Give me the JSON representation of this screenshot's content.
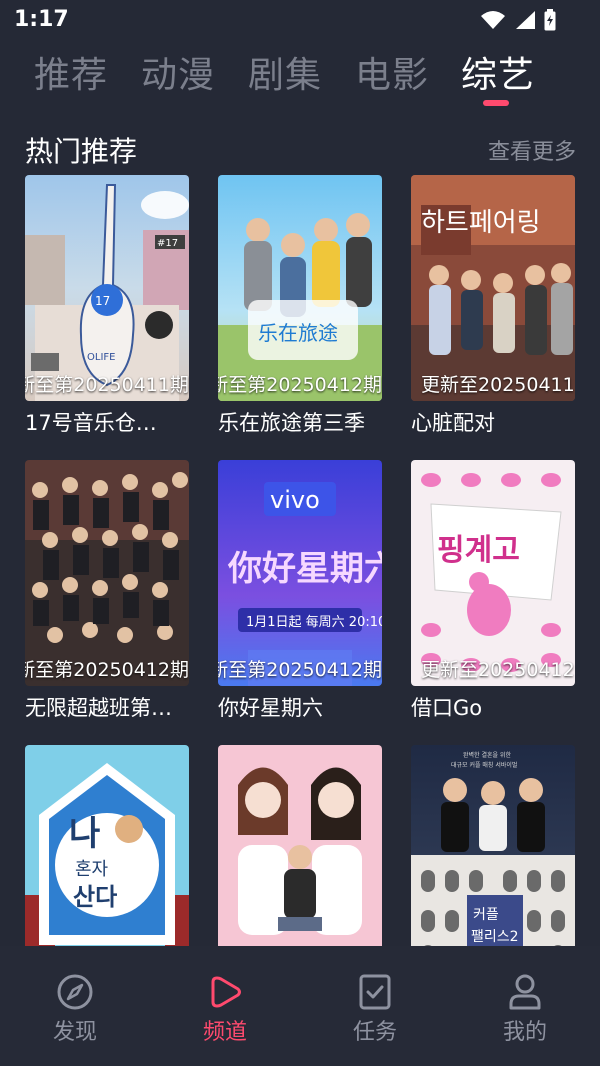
{
  "status_bar": {
    "time": "1:17"
  },
  "top_tabs": [
    {
      "label": "推荐"
    },
    {
      "label": "动漫"
    },
    {
      "label": "剧集"
    },
    {
      "label": "电影"
    },
    {
      "label": "综艺",
      "active": true
    }
  ],
  "section": {
    "title": "热门推荐",
    "more_label": "查看更多"
  },
  "cards": [
    {
      "title": "17号音乐仓…",
      "caption": "新至第20250411期",
      "poster_label": "17号音乐仓"
    },
    {
      "title": "乐在旅途第三季",
      "caption": "新至第20250412期",
      "poster_label": "乐在旅途"
    },
    {
      "title": "心脏配对",
      "caption": "更新至20250411",
      "poster_label": "하트페어링"
    },
    {
      "title": "无限超越班第…",
      "caption": "新至第20250412期",
      "poster_label": ""
    },
    {
      "title": "你好星期六",
      "caption": "新至第20250412期",
      "poster_label": "vivo"
    },
    {
      "title": "借口Go",
      "caption": "更新至20250412",
      "poster_label": "핑계고"
    },
    {
      "title": "",
      "caption": "",
      "poster_label": "나 혼자 산다"
    },
    {
      "title": "",
      "caption": "",
      "poster_label": ""
    },
    {
      "title": "",
      "caption": "",
      "poster_label": "커플 팰리스2"
    }
  ],
  "bottom_nav": [
    {
      "label": "发现",
      "icon": "compass-icon"
    },
    {
      "label": "频道",
      "icon": "play-icon",
      "active": true
    },
    {
      "label": "任务",
      "icon": "task-icon"
    },
    {
      "label": "我的",
      "icon": "user-icon"
    }
  ],
  "colors": {
    "background": "#252936",
    "accent": "#ff4a6e",
    "muted": "#7b7f8c"
  }
}
